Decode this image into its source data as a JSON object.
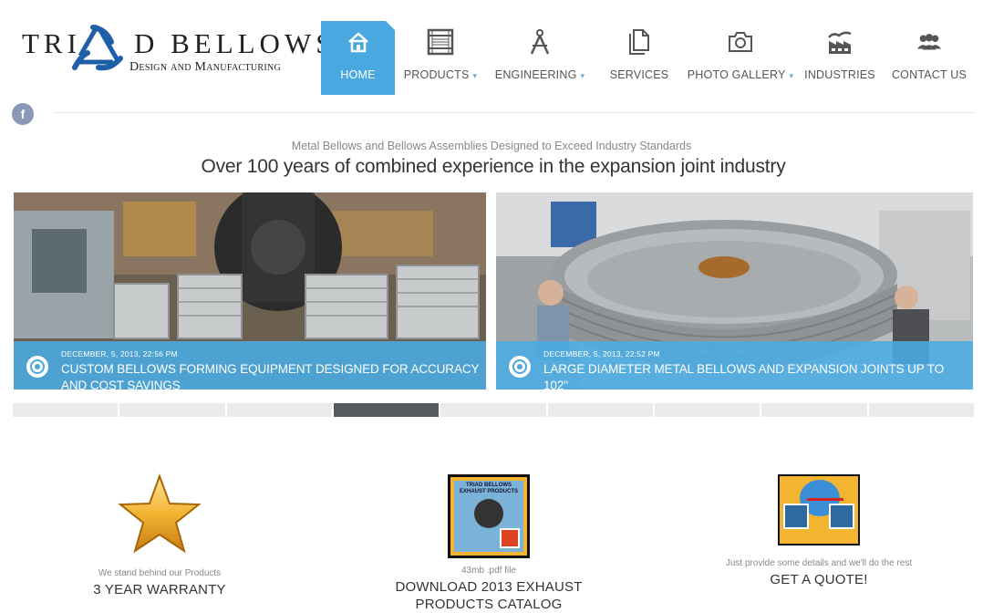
{
  "logo": {
    "line1_left": "TRI",
    "line1_right": "D BELLOWS",
    "line2": "Design and Manufacturing"
  },
  "nav": {
    "items": [
      {
        "label": "HOME",
        "icon": "home-icon",
        "dropdown": false
      },
      {
        "label": "PRODUCTS",
        "icon": "film-icon",
        "dropdown": true
      },
      {
        "label": "ENGINEERING",
        "icon": "compass-icon",
        "dropdown": true
      },
      {
        "label": "SERVICES",
        "icon": "documents-icon",
        "dropdown": false
      },
      {
        "label": "PHOTO GALLERY",
        "icon": "camera-icon",
        "dropdown": true
      },
      {
        "label": "INDUSTRIES",
        "icon": "factory-icon",
        "dropdown": false
      },
      {
        "label": "CONTACT US",
        "icon": "people-icon",
        "dropdown": false
      }
    ],
    "active": "HOME"
  },
  "social": {
    "facebook_letter": "f"
  },
  "intro": {
    "subtitle": "Metal Bellows and Bellows Assemblies Designed to Exceed Industry Standards",
    "headline": "Over 100 years of combined experience in the expansion joint industry"
  },
  "slides": [
    {
      "date": "DECEMBER, 5, 2013, 22:56 PM",
      "title": "CUSTOM BELLOWS FORMING EQUIPMENT DESIGNED FOR ACCURACY AND COST SAVINGS"
    },
    {
      "date": "DECEMBER, 5, 2013, 22:52 PM",
      "title": "LARGE DIAMETER METAL BELLOWS AND EXPANSION JOINTS UP TO 102\""
    }
  ],
  "pager": {
    "count": 9,
    "active_index": 3
  },
  "features": [
    {
      "small": "We stand behind our Products",
      "big": "3 YEAR WARRANTY",
      "icon": "star-icon"
    },
    {
      "small": "43mb .pdf file",
      "big": "DOWNLOAD 2013 EXHAUST PRODUCTS CATALOG",
      "icon": "catalog-icon",
      "thumb_text": "TRIAD BELLOWS EXHAUST PRODUCTS"
    },
    {
      "small": "Just provide some details and we'll do the rest",
      "big": "GET A QUOTE!",
      "icon": "quote-icon"
    }
  ],
  "colors": {
    "accent": "#4aa8e0",
    "pager_active": "#555a5e",
    "logo_blue": "#1f5fa8"
  }
}
